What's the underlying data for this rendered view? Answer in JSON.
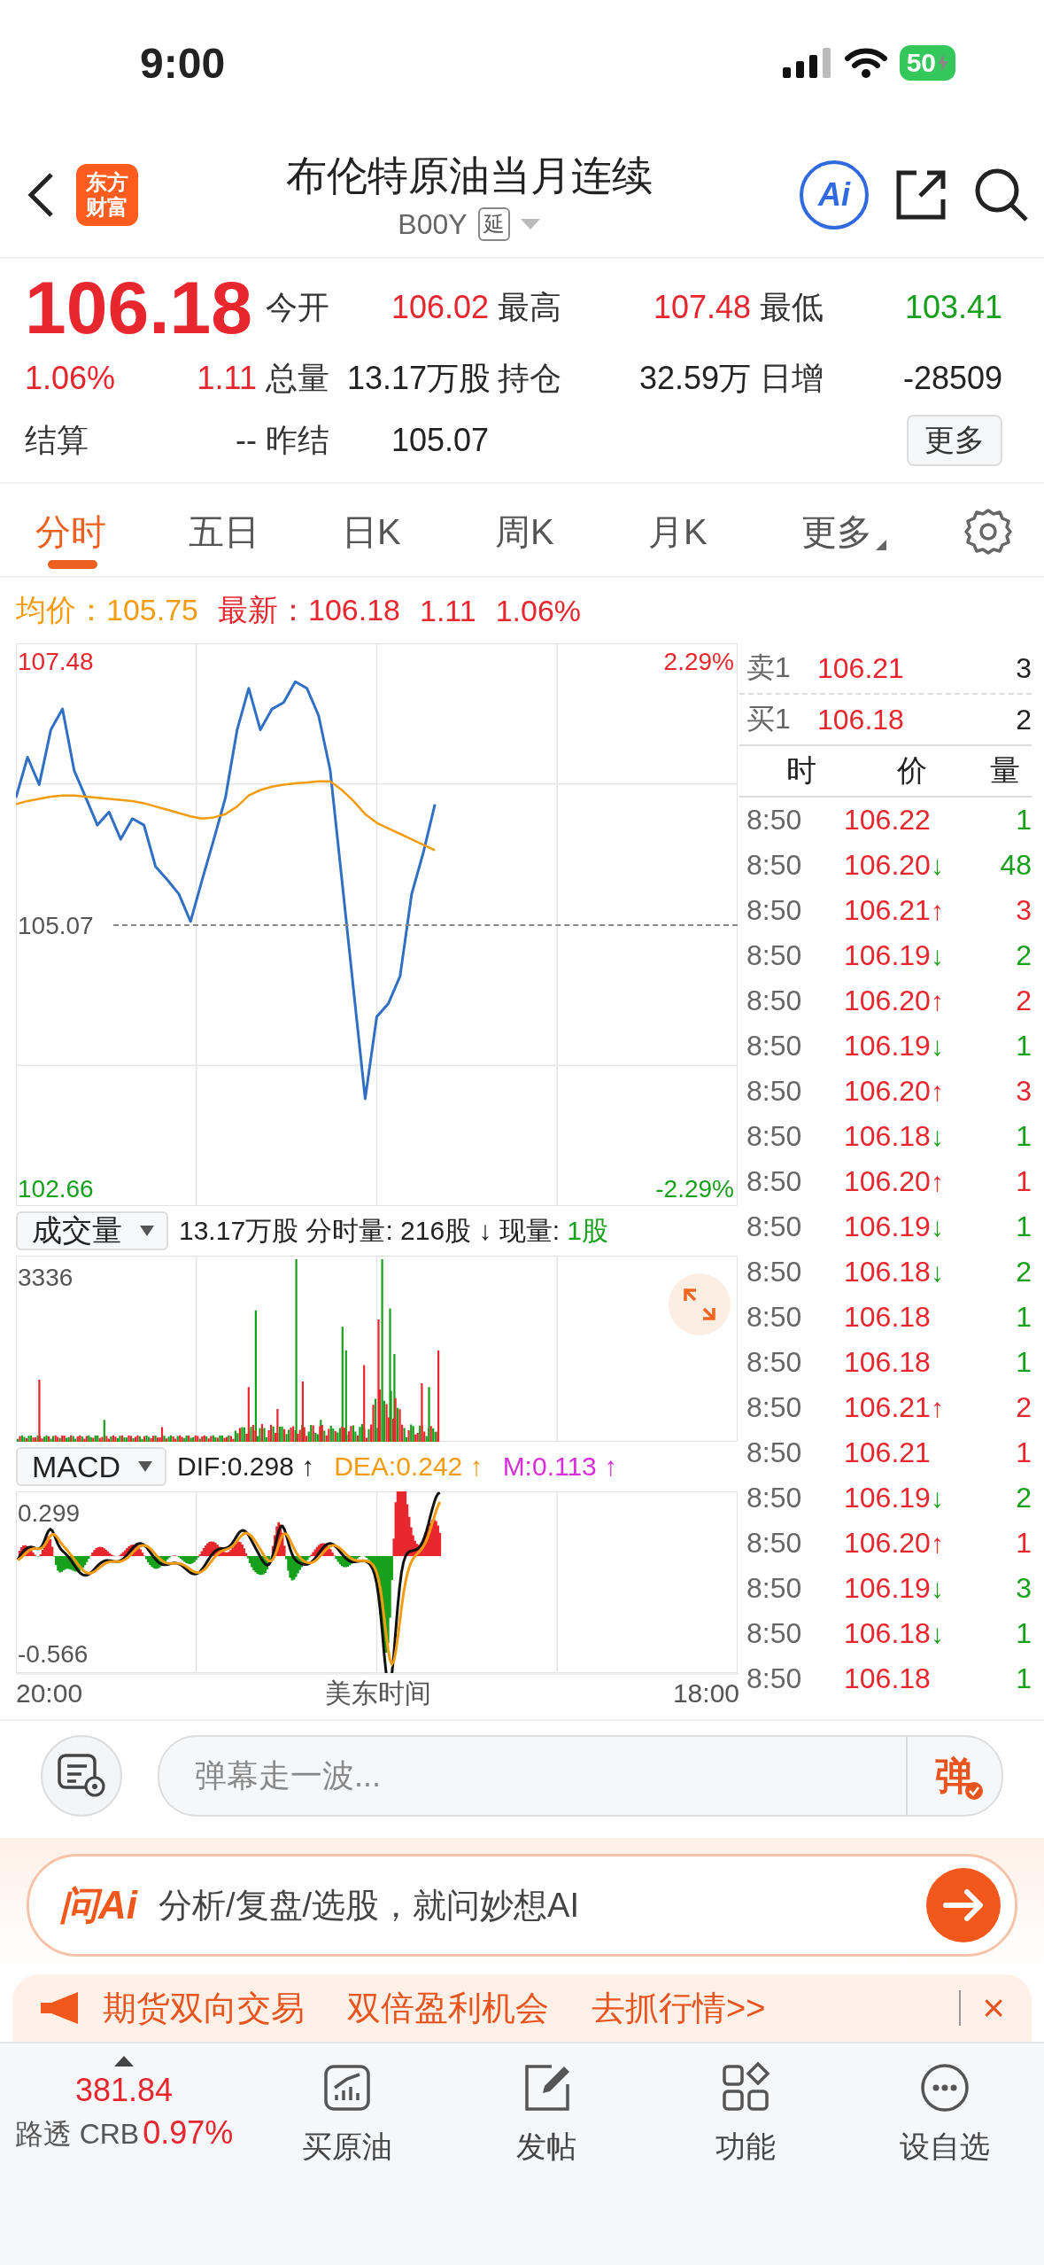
{
  "status_bar": {
    "time": "9:00",
    "battery": "50"
  },
  "header": {
    "logo_lines": [
      "东方",
      "财富"
    ],
    "title": "布伦特原油当月连续",
    "code": "B00Y",
    "badge": "延",
    "ai_label": "Ai"
  },
  "quote": {
    "price": "106.18",
    "change_pct": "1.06%",
    "change": "1.11",
    "settle_label": "结算",
    "settle_value": "--",
    "stats": [
      {
        "label": "今开",
        "value": "106.02",
        "color": "#e8262d"
      },
      {
        "label": "最高",
        "value": "107.48",
        "color": "#e8262d"
      },
      {
        "label": "最低",
        "value": "103.41",
        "color": "#17a01c"
      },
      {
        "label": "总量",
        "value": "13.17万股",
        "color": "#222222"
      },
      {
        "label": "持仓",
        "value": "32.59万",
        "color": "#222222"
      },
      {
        "label": "日增",
        "value": "-28509",
        "color": "#222222"
      },
      {
        "label": "昨结",
        "value": "105.07",
        "color": "#222222"
      }
    ],
    "more_button": "更多"
  },
  "tabs": [
    {
      "label": "分时",
      "selected": true,
      "kind": "tab"
    },
    {
      "label": "五日",
      "selected": false,
      "kind": "tab"
    },
    {
      "label": "日K",
      "selected": false,
      "kind": "tab"
    },
    {
      "label": "周K",
      "selected": false,
      "kind": "tab"
    },
    {
      "label": "月K",
      "selected": false,
      "kind": "tab"
    },
    {
      "label": "更多",
      "selected": false,
      "kind": "menu"
    }
  ],
  "info": {
    "avg_label": "均价：",
    "avg_value": "105.75",
    "latest_label": "最新：",
    "latest_price": "106.18",
    "latest_change": "1.11",
    "latest_pct": "1.06%"
  },
  "price_chart": {
    "chart_data": {
      "type": "line",
      "categories": [
        null,
        null,
        null,
        null,
        null,
        null,
        null,
        null,
        null,
        null,
        null,
        null,
        null,
        null,
        null,
        null,
        null,
        null,
        null,
        null,
        null,
        null,
        null,
        null,
        null,
        null,
        null,
        null,
        null,
        null,
        null,
        null,
        null,
        null,
        null,
        null,
        null,
        null,
        null,
        null,
        null,
        null,
        null,
        null,
        null,
        null,
        null,
        null,
        null,
        null,
        null,
        null,
        null,
        null,
        null,
        null,
        null,
        null,
        null,
        null,
        null,
        null,
        null
      ],
      "series": [
        {
          "color": "#2f6fc4",
          "values": [
            106.23,
            106.6,
            106.35,
            106.85,
            107.04,
            106.48,
            106.23,
            105.98,
            106.1,
            105.85,
            106.04,
            105.98,
            105.6,
            105.48,
            105.35,
            105.1,
            105.48,
            105.85,
            106.23,
            106.85,
            107.23,
            106.85,
            107.04,
            107.1,
            107.29,
            107.23,
            106.98,
            106.48,
            105.48,
            104.48,
            103.48,
            104.23,
            104.35,
            104.6,
            105.35,
            105.73,
            106.17,
            null,
            null,
            null,
            null,
            null,
            null,
            null,
            null,
            null,
            null,
            null,
            null,
            null,
            null,
            null,
            null,
            null,
            null,
            null,
            null,
            null,
            null,
            null,
            null,
            null,
            null
          ]
        },
        {
          "color": "#f39c12",
          "values": [
            106.17,
            106.2,
            106.22,
            106.24,
            106.25,
            106.25,
            106.24,
            106.23,
            106.22,
            106.21,
            106.2,
            106.18,
            106.15,
            106.12,
            106.09,
            106.06,
            106.04,
            106.05,
            106.08,
            106.15,
            106.25,
            106.3,
            106.33,
            106.35,
            106.36,
            106.37,
            106.38,
            106.38,
            106.3,
            106.2,
            106.08,
            106.0,
            105.95,
            105.9,
            105.85,
            105.8,
            105.75,
            null,
            null,
            null,
            null,
            null,
            null,
            null,
            null,
            null,
            null,
            null,
            null,
            null,
            null,
            null,
            null,
            null,
            null,
            null,
            null,
            null,
            null,
            null,
            null,
            null,
            null
          ]
        }
      ],
      "ylim": [
        102.5,
        107.64
      ],
      "yticks": [
        {
          "value": 107.48,
          "label": "107.48"
        },
        {
          "value": 105.07,
          "label": "105.07"
        },
        {
          "value": 102.66,
          "label": "102.66"
        }
      ]
    },
    "right_ticks": [
      {
        "label": "2.29%",
        "color": "#e8262d"
      },
      {
        "label": "-2.29%",
        "color": "#17a01c"
      }
    ]
  },
  "volume": {
    "selector": "成交量",
    "summary": "13.17万股 分时量: 216股 ↓ 现量:",
    "current": "1股",
    "max_label": "3336"
  },
  "macd": {
    "selector": "MACD",
    "indicators": [
      {
        "text": "DIF:0.298 ↑",
        "color": "#222222"
      },
      {
        "text": "DEA:0.242 ↑",
        "color": "#f39c12"
      },
      {
        "text": "M:0.113 ↑",
        "color": "#d72fd7"
      }
    ],
    "top_label": "0.299",
    "bottom_label": "-0.566"
  },
  "axis": {
    "start": "20:00",
    "middle": "美东时间",
    "end": "18:00"
  },
  "order_book": {
    "levels": [
      {
        "label": "卖1",
        "price": "106.21",
        "volume": "3"
      },
      {
        "label": "买1",
        "price": "106.18",
        "volume": "2"
      }
    ],
    "columns": [
      "时",
      "价",
      "量"
    ],
    "ticks": [
      {
        "time": "8:50",
        "price": "106.22",
        "color": "#17a01c",
        "volume": "1"
      },
      {
        "time": "8:50",
        "price": "106.20",
        "arrow": "↓",
        "rising": false,
        "color": "#17a01c",
        "volume": "48"
      },
      {
        "time": "8:50",
        "price": "106.21",
        "arrow": "↑",
        "rising": true,
        "color": "#e8262d",
        "volume": "3"
      },
      {
        "time": "8:50",
        "price": "106.19",
        "arrow": "↓",
        "rising": false,
        "color": "#17a01c",
        "volume": "2"
      },
      {
        "time": "8:50",
        "price": "106.20",
        "arrow": "↑",
        "rising": true,
        "color": "#e8262d",
        "volume": "2"
      },
      {
        "time": "8:50",
        "price": "106.19",
        "arrow": "↓",
        "rising": false,
        "color": "#17a01c",
        "volume": "1"
      },
      {
        "time": "8:50",
        "price": "106.20",
        "arrow": "↑",
        "rising": true,
        "color": "#e8262d",
        "volume": "3"
      },
      {
        "time": "8:50",
        "price": "106.18",
        "arrow": "↓",
        "rising": false,
        "color": "#17a01c",
        "volume": "1"
      },
      {
        "time": "8:50",
        "price": "106.20",
        "arrow": "↑",
        "rising": true,
        "color": "#e8262d",
        "volume": "1"
      },
      {
        "time": "8:50",
        "price": "106.19",
        "arrow": "↓",
        "rising": false,
        "color": "#17a01c",
        "volume": "1"
      },
      {
        "time": "8:50",
        "price": "106.18",
        "arrow": "↓",
        "rising": false,
        "color": "#17a01c",
        "volume": "2"
      },
      {
        "time": "8:50",
        "price": "106.18",
        "color": "#17a01c",
        "volume": "1"
      },
      {
        "time": "8:50",
        "price": "106.18",
        "color": "#17a01c",
        "volume": "1"
      },
      {
        "time": "8:50",
        "price": "106.21",
        "arrow": "↑",
        "rising": true,
        "color": "#e8262d",
        "volume": "2"
      },
      {
        "time": "8:50",
        "price": "106.21",
        "color": "#e8262d",
        "volume": "1"
      },
      {
        "time": "8:50",
        "price": "106.19",
        "arrow": "↓",
        "rising": false,
        "color": "#17a01c",
        "volume": "2"
      },
      {
        "time": "8:50",
        "price": "106.20",
        "arrow": "↑",
        "rising": true,
        "color": "#e8262d",
        "volume": "1"
      },
      {
        "time": "8:50",
        "price": "106.19",
        "arrow": "↓",
        "rising": false,
        "color": "#17a01c",
        "volume": "3"
      },
      {
        "time": "8:50",
        "price": "106.18",
        "arrow": "↓",
        "rising": false,
        "color": "#17a01c",
        "volume": "1"
      },
      {
        "time": "8:50",
        "price": "106.18",
        "color": "#17a01c",
        "volume": "1"
      }
    ]
  },
  "comment_bar": {
    "placeholder": "弹幕走一波...",
    "send_label": "弹"
  },
  "ai_bar": {
    "logo": "问Ai",
    "prompt": "分析/复盘/选股，就问妙想AI"
  },
  "banner": {
    "segments": [
      "期货双向交易",
      "双倍盈利机会",
      "去抓行情>>"
    ],
    "close": "×"
  },
  "bottom_nav": {
    "index": {
      "value": "381.84",
      "name": "路透 CRB",
      "pct": "0.97%"
    },
    "items": [
      {
        "label": "买原油",
        "kind": "chart"
      },
      {
        "label": "发帖",
        "kind": "edit"
      },
      {
        "label": "功能",
        "kind": "apps"
      },
      {
        "label": "设自选",
        "kind": "more"
      }
    ]
  }
}
